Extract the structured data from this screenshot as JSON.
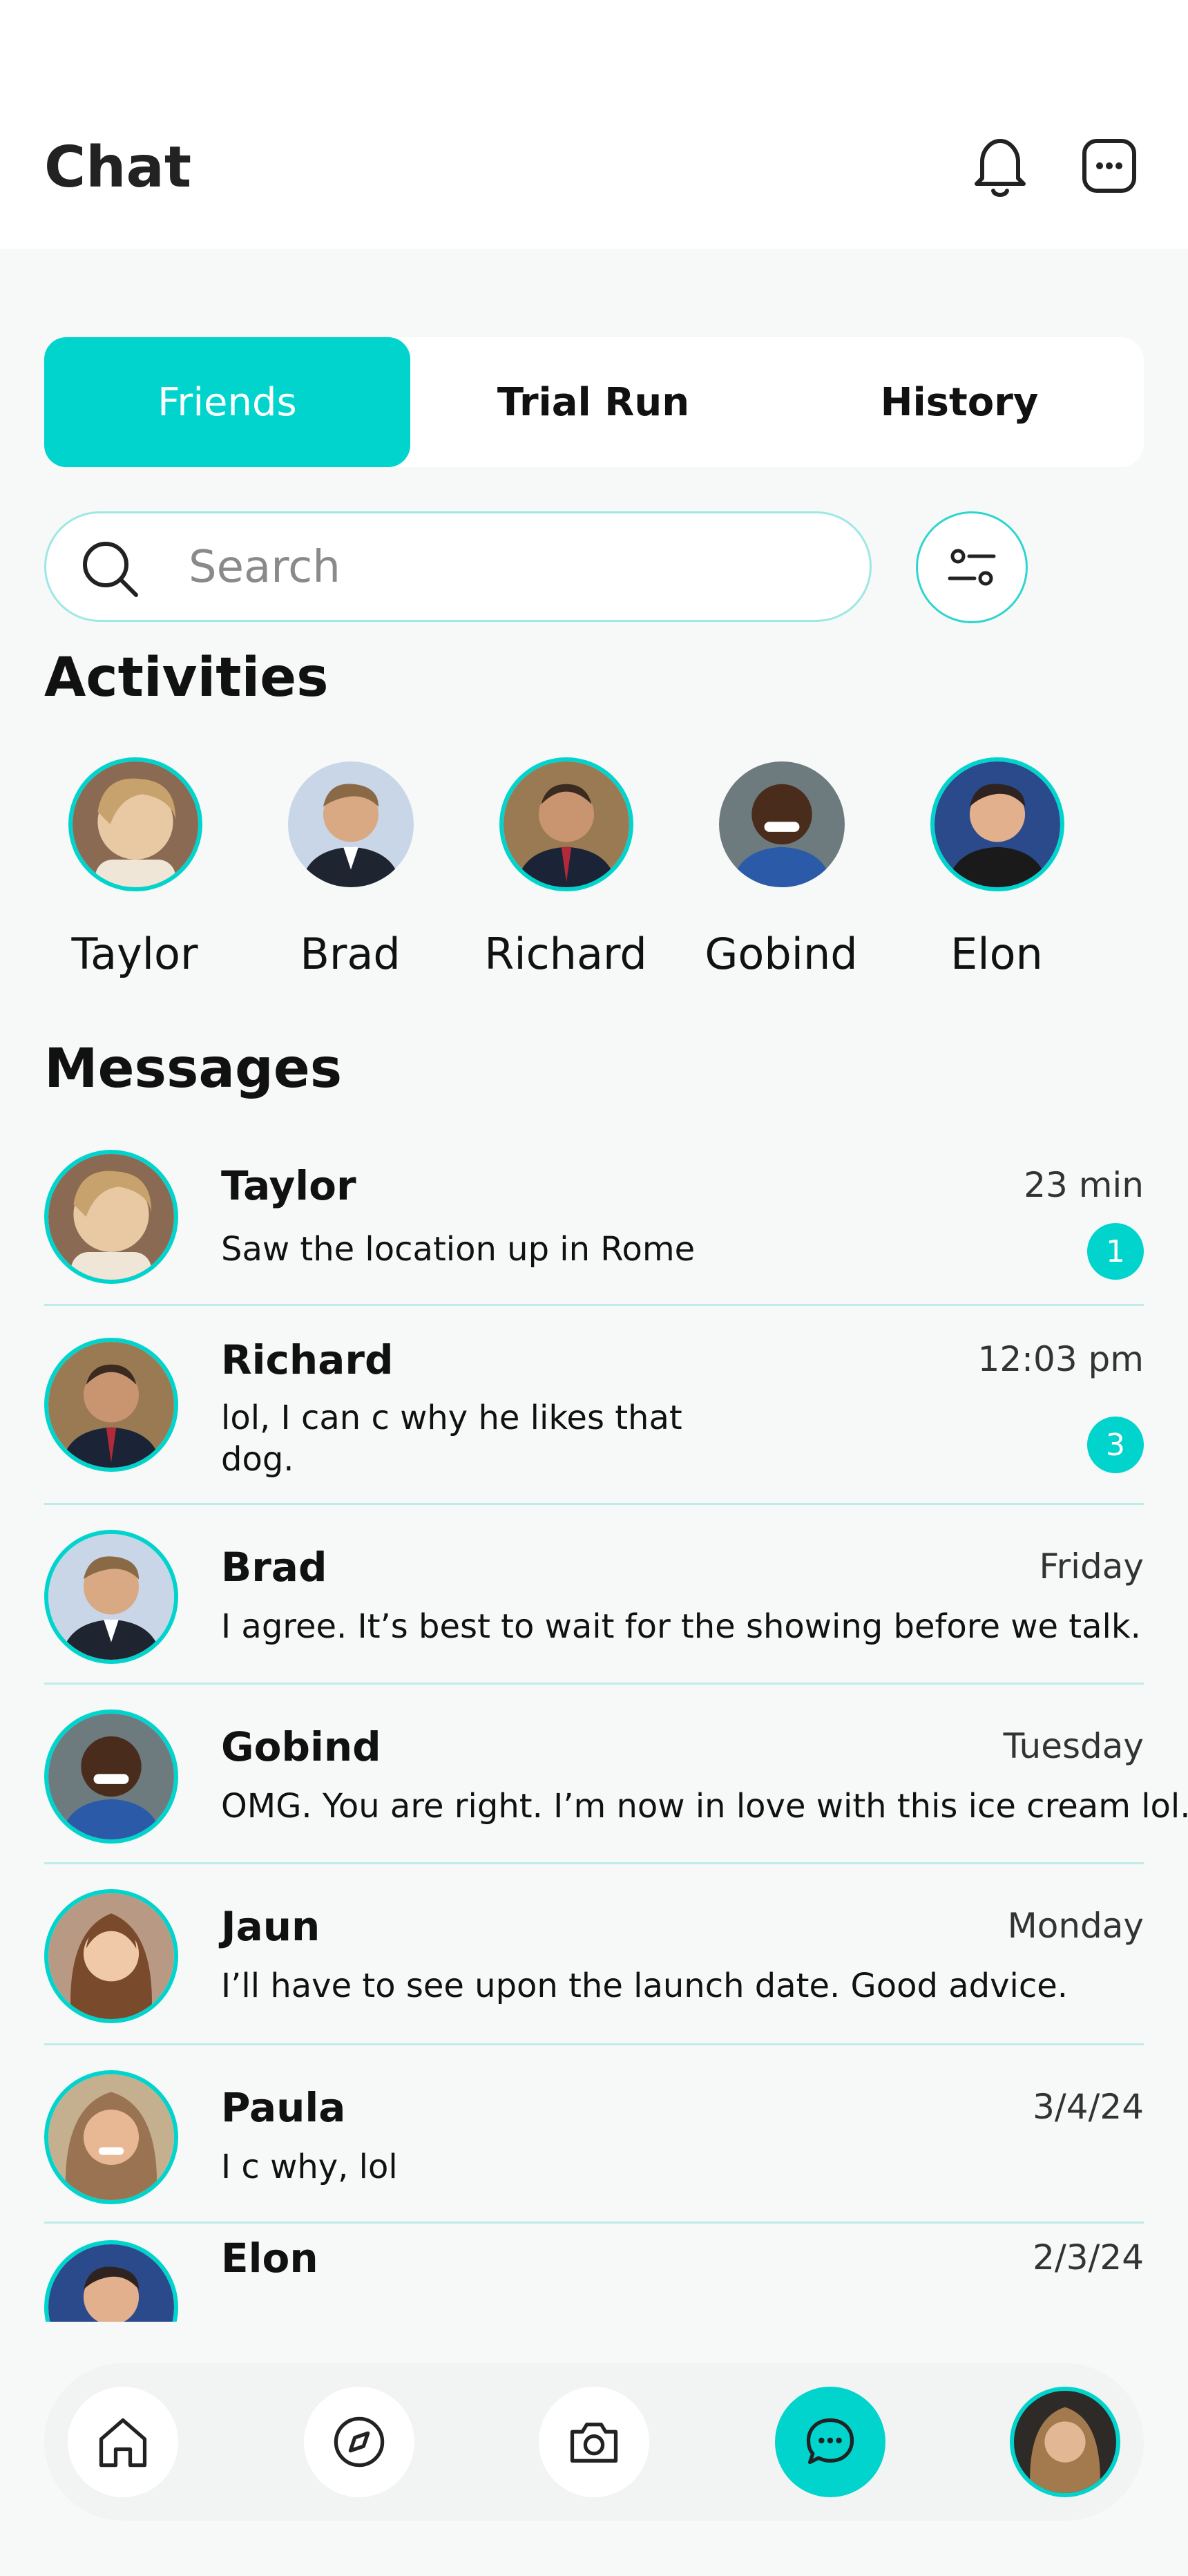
{
  "header": {
    "title": "Chat"
  },
  "tabs": [
    {
      "label": "Friends",
      "active": true
    },
    {
      "label": "Trial Run",
      "active": false
    },
    {
      "label": "History",
      "active": false
    }
  ],
  "search": {
    "placeholder": "Search",
    "value": ""
  },
  "activities": {
    "title": "Activities",
    "items": [
      {
        "name": "Taylor"
      },
      {
        "name": "Brad"
      },
      {
        "name": "Richard"
      },
      {
        "name": "Gobind"
      },
      {
        "name": "Elon"
      }
    ]
  },
  "messages": {
    "title": "Messages",
    "items": [
      {
        "name": "Taylor",
        "time": "23 min",
        "text": "Saw the location up in Rome",
        "unread": "1"
      },
      {
        "name": "Richard",
        "time": "12:03 pm",
        "text": "lol, I can c why he likes that dog.",
        "unread": "3"
      },
      {
        "name": "Brad",
        "time": "Friday",
        "text": "I agree. It’s best to wait for the showing before we talk."
      },
      {
        "name": "Gobind",
        "time": "Tuesday",
        "text": "OMG. You  are right. I’m now in love with this ice cream lol."
      },
      {
        "name": "Jaun",
        "time": "Monday",
        "text": "I’ll have to see upon the launch date. Good advice."
      },
      {
        "name": "Paula",
        "time": "3/4/24",
        "text": "I c why, lol"
      },
      {
        "name": "Elon",
        "time": "2/3/24"
      }
    ]
  },
  "colors": {
    "accent": "#00d4cd",
    "divider": "#bfecea",
    "background": "#f7f8f8"
  },
  "bottom_nav": [
    "home-icon",
    "compass-icon",
    "camera-icon",
    "chat-icon",
    "profile-avatar"
  ]
}
